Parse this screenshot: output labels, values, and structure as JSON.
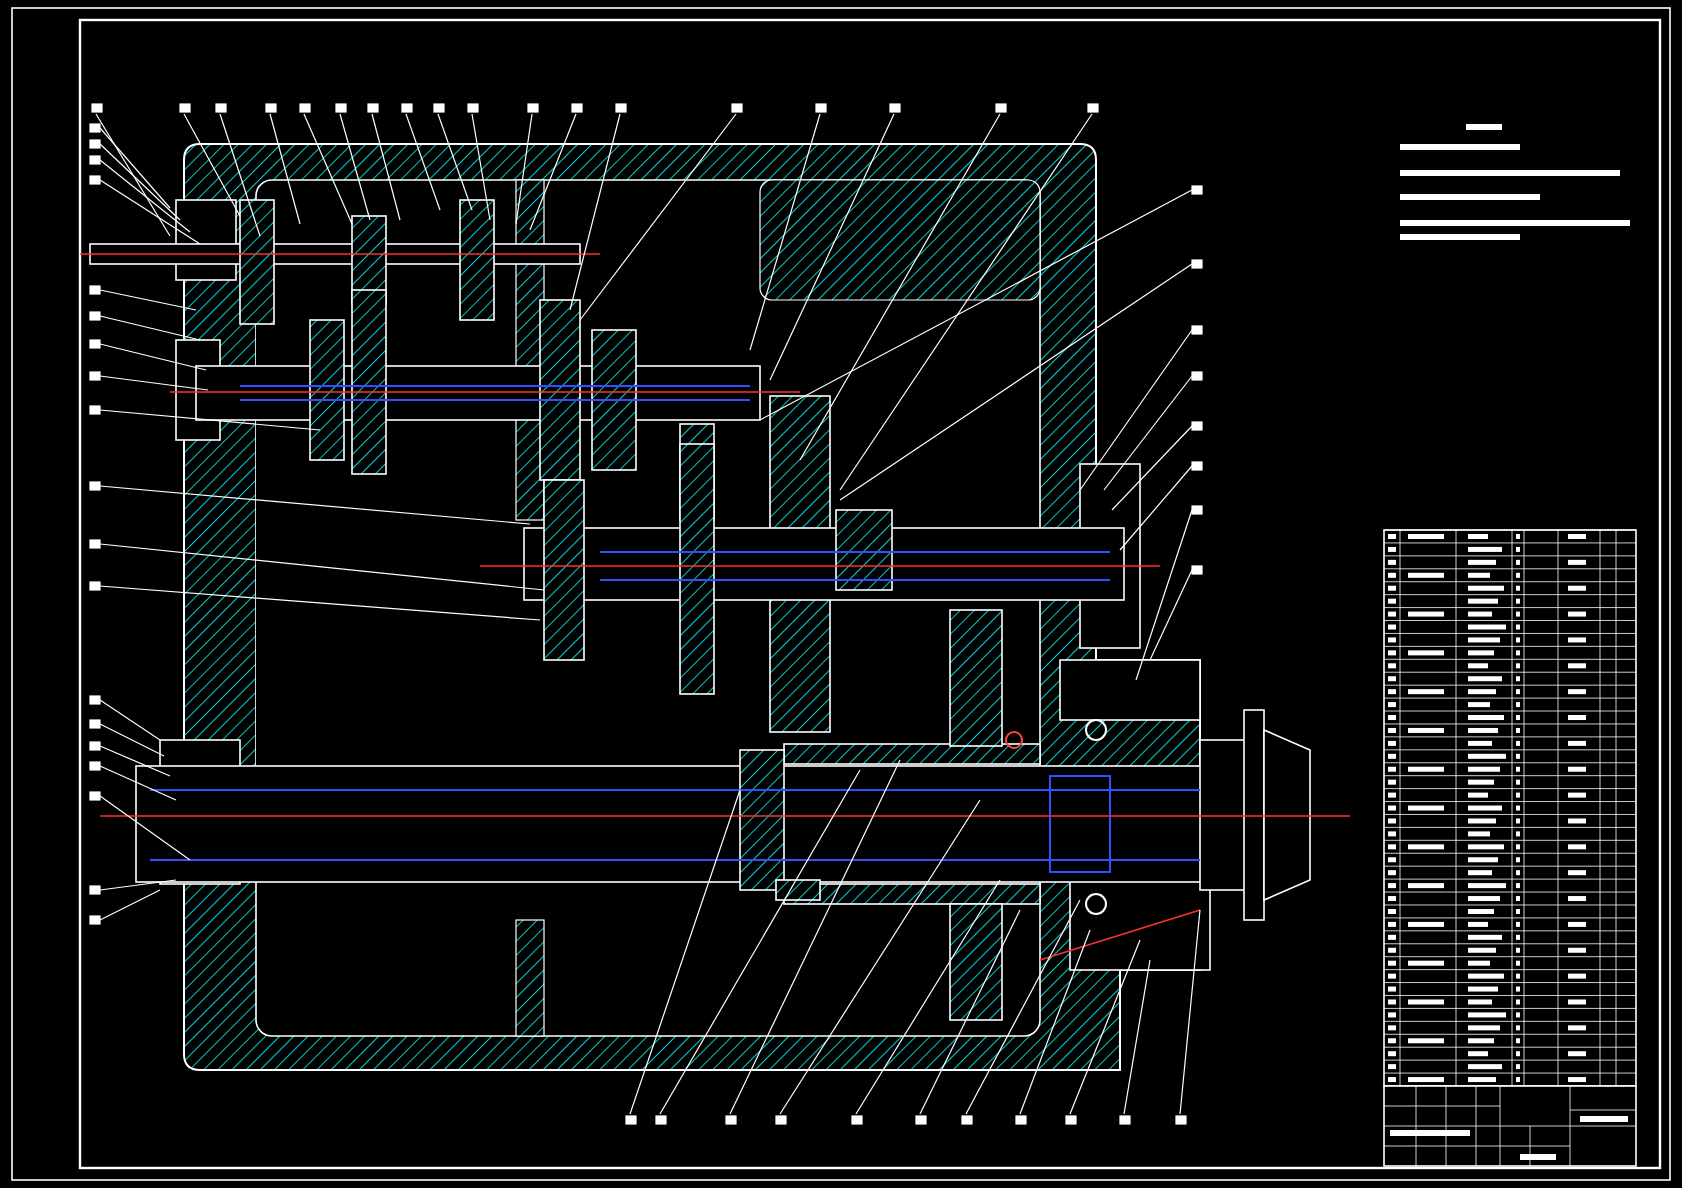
{
  "sheet": {
    "kind": "gearbox-section"
  },
  "notes": {
    "kind": "illegible-text"
  },
  "parts_list": {
    "kind": "grid"
  },
  "title_block": {
    "kind": "grid"
  }
}
